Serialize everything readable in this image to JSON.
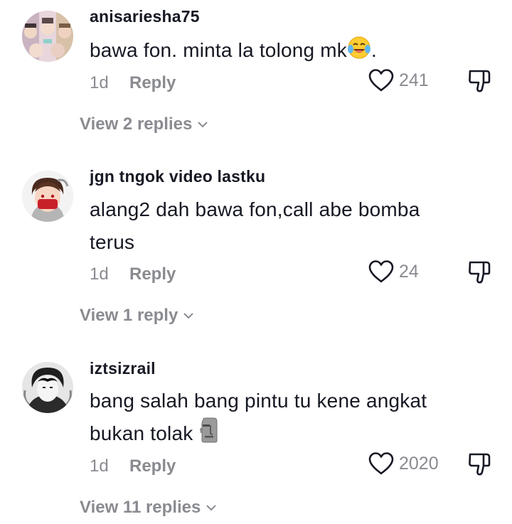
{
  "comments": [
    {
      "username": "anisariesha75",
      "text": "bawa fon. minta la tolong mk",
      "text_suffix": ".",
      "emoji": "laughing-crying-emoji",
      "time": "1d",
      "reply_label": "Reply",
      "likes": "241",
      "view_replies": "View 2 replies"
    },
    {
      "username": "jgn tngok video lastku",
      "text_line1": "alang2 dah bawa fon,call abe bomba",
      "text_line2": "terus",
      "time": "1d",
      "reply_label": "Reply",
      "likes": "24",
      "view_replies": "View 1 reply"
    },
    {
      "username": "iztsizrail",
      "text_line1": "bang salah bang pintu tu kene angkat",
      "text_line2": "bukan tolak",
      "emoji": "moai-emoji",
      "time": "1d",
      "reply_label": "Reply",
      "likes": "2020",
      "view_replies": "View 11 replies"
    }
  ],
  "colors": {
    "primary_text": "#161823",
    "secondary_text": "#8a8b91",
    "icon_stroke": "#161823"
  }
}
